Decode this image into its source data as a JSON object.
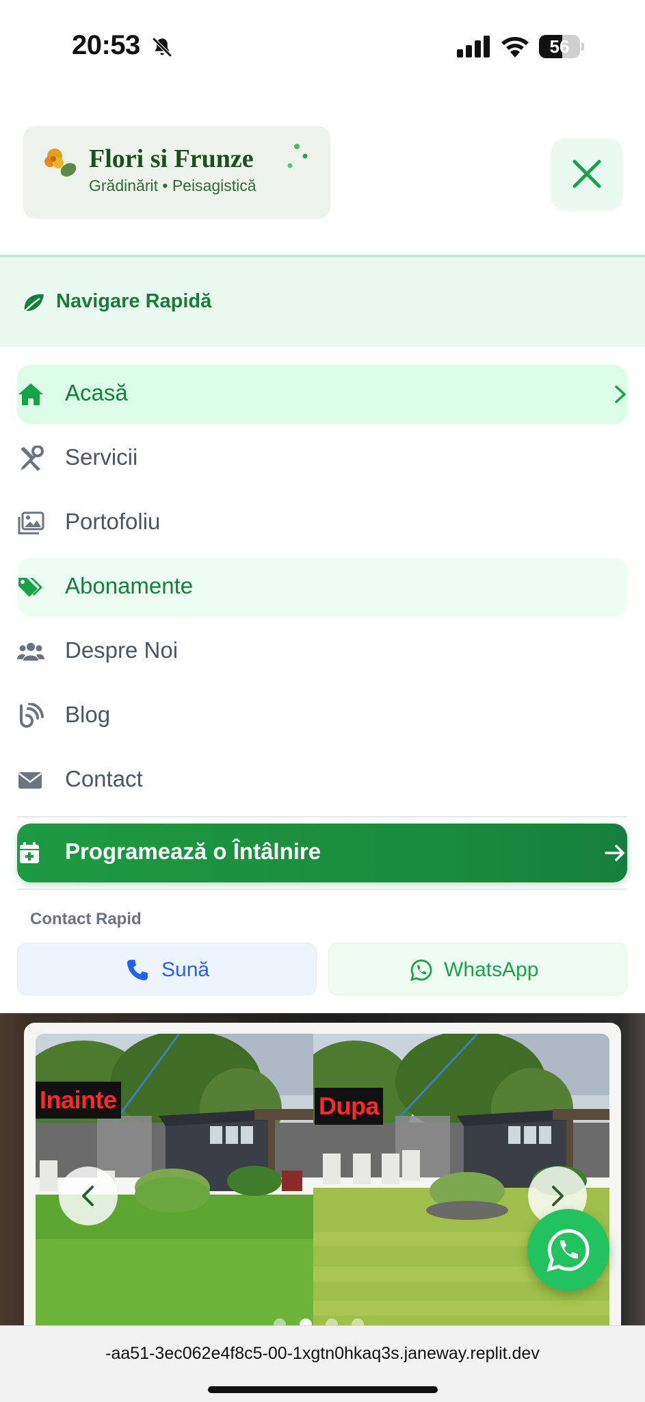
{
  "status_bar": {
    "time": "20:53",
    "battery": "56",
    "battery_level": 0.56
  },
  "header": {
    "logo_title": "Flori si Frunze",
    "logo_subtitle": "Grădinărit • Peisagistică"
  },
  "quick_nav": {
    "label": "Navigare Rapidă"
  },
  "menu": {
    "items": [
      {
        "label": "Acasă",
        "icon": "home-icon",
        "state": "active"
      },
      {
        "label": "Servicii",
        "icon": "tools-icon",
        "state": "normal"
      },
      {
        "label": "Portofoliu",
        "icon": "images-icon",
        "state": "normal"
      },
      {
        "label": "Abonamente",
        "icon": "tags-icon",
        "state": "highlight"
      },
      {
        "label": "Despre Noi",
        "icon": "users-icon",
        "state": "normal"
      },
      {
        "label": "Blog",
        "icon": "blog-icon",
        "state": "normal"
      },
      {
        "label": "Contact",
        "icon": "envelope-icon",
        "state": "normal"
      }
    ]
  },
  "cta": {
    "label": "Programează o Întâlnire"
  },
  "quick_contact": {
    "title": "Contact Rapid",
    "call_label": "Sună",
    "whatsapp_label": "WhatsApp"
  },
  "gallery": {
    "before_tag": "Inainte",
    "after_tag": "Dupa",
    "slide_count": 4,
    "active_slide": 2
  },
  "browser": {
    "url": "-aa51-3ec062e4f8c5-00-1xgtn0hkaq3s.janeway.replit.dev"
  },
  "colors": {
    "brand_green": "#15803d",
    "active_bg": "#dcfce7",
    "call_blue": "#2563eb",
    "whatsapp_green": "#22c35e"
  }
}
